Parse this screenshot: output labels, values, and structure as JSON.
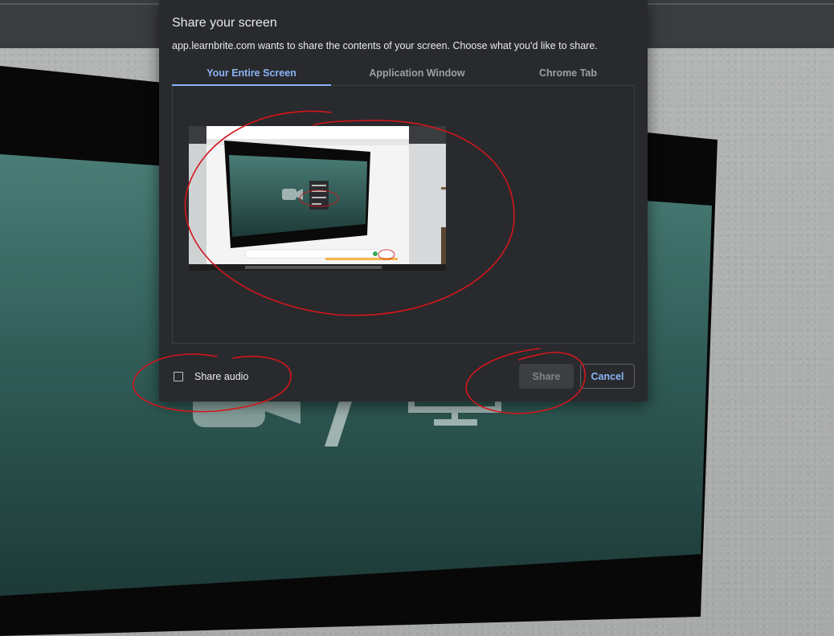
{
  "dialog": {
    "title": "Share your screen",
    "description": "app.learnbrite.com wants to share the contents of your screen. Choose what you'd like to share."
  },
  "tabs": [
    {
      "label": "Your Entire Screen",
      "active": true
    },
    {
      "label": "Application Window",
      "active": false
    },
    {
      "label": "Chrome Tab",
      "active": false
    }
  ],
  "audio": {
    "label": "Share audio",
    "checked": false
  },
  "buttons": {
    "share_label": "Share",
    "share_enabled": false,
    "cancel_label": "Cancel"
  },
  "colors": {
    "dialog_bg": "#292a2d",
    "accent_blue": "#8ab4f8",
    "annotation_red": "#d4161c",
    "screen_teal": "#2f5a55"
  },
  "icons": [
    "video-camera-icon",
    "monitor-icon",
    "checkbox-icon"
  ]
}
